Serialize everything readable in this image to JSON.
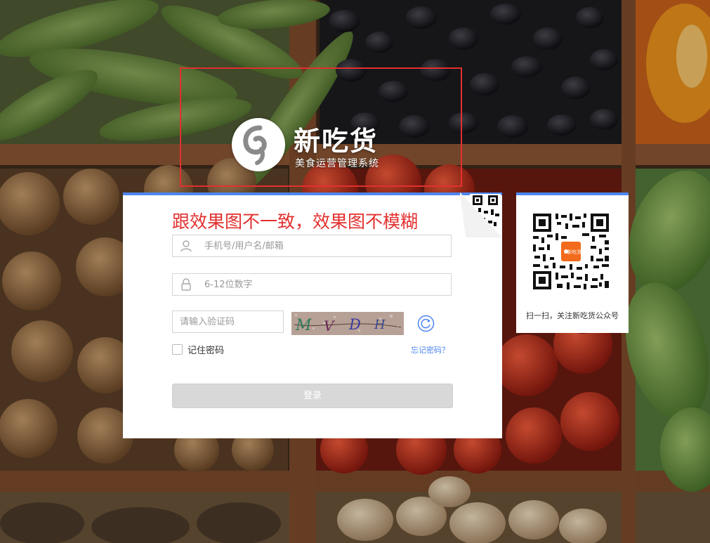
{
  "brand": {
    "name": "新吃货",
    "subtitle": "美食运营管理系统"
  },
  "annotation": {
    "note": "跟效果图不一致，效果图不模糊"
  },
  "login": {
    "username_placeholder": "手机号/用户名/邮箱",
    "password_placeholder": "6-12位数字",
    "captcha_placeholder": "请输入验证码",
    "captcha_text": "M V D H",
    "remember_label": "记住密码",
    "remember_checked": false,
    "forgot_label": "忘记密码？",
    "submit_label": "登录"
  },
  "qr": {
    "caption": "扫一扫，关注新吃货公众号",
    "center_label": "新吃货"
  },
  "colors": {
    "accent": "#4c86f0",
    "annotation_red": "#e2302f",
    "brand_orange": "#f26a1b"
  }
}
